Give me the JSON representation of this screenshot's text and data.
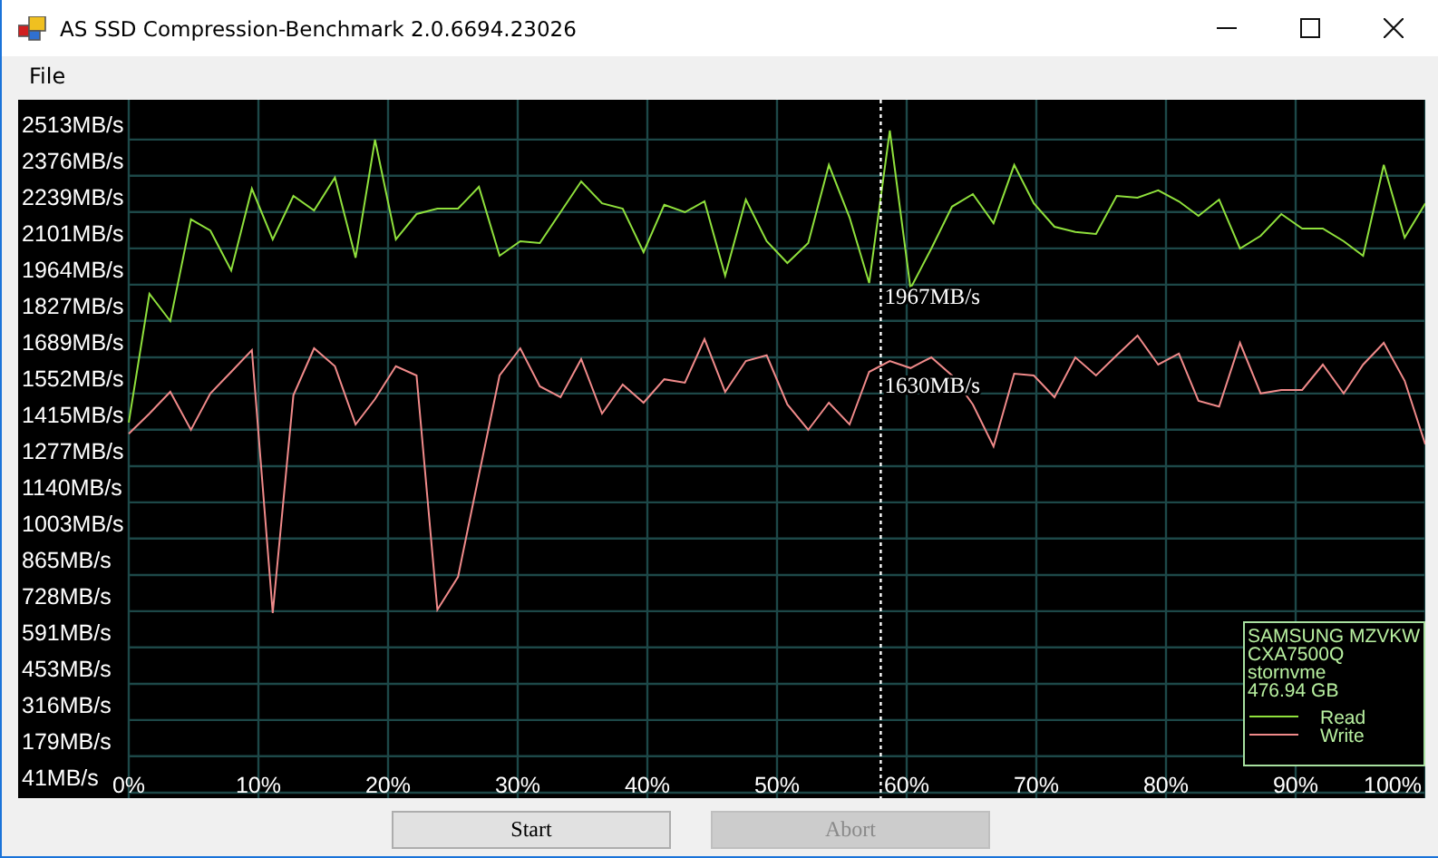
{
  "window": {
    "title": "AS SSD Compression-Benchmark 2.0.6694.23026"
  },
  "menu": [
    {
      "label": "File"
    }
  ],
  "chart": {
    "chart_data": {
      "type": "line",
      "x": [
        0,
        1.6,
        3.2,
        4.8,
        6.3,
        7.9,
        9.5,
        11.1,
        12.7,
        14.3,
        15.9,
        17.5,
        19.0,
        20.6,
        22.2,
        23.8,
        25.4,
        27.0,
        28.6,
        30.2,
        31.7,
        33.3,
        34.9,
        36.5,
        38.1,
        39.7,
        41.3,
        42.9,
        44.4,
        46.0,
        47.6,
        49.2,
        50.8,
        52.4,
        54.0,
        55.6,
        57.1,
        58.7,
        60.3,
        61.9,
        63.5,
        65.1,
        66.7,
        68.3,
        69.8,
        71.4,
        73.0,
        74.6,
        76.2,
        77.8,
        79.4,
        81.0,
        82.5,
        84.1,
        85.7,
        87.3,
        88.9,
        90.5,
        92.1,
        93.7,
        95.2,
        96.8,
        98.4,
        100
      ],
      "series": [
        {
          "name": "Read",
          "color": "#8fe03c",
          "values": [
            1442,
            1929,
            1826,
            2211,
            2169,
            2018,
            2327,
            2135,
            2300,
            2245,
            2369,
            2066,
            2513,
            2135,
            2231,
            2252,
            2252,
            2334,
            2073,
            2128,
            2121,
            2238,
            2355,
            2272,
            2252,
            2087,
            2266,
            2238,
            2279,
            1998,
            2286,
            2128,
            2046,
            2121,
            2417,
            2218,
            1970,
            2547,
            1950,
            2101,
            2259,
            2307,
            2197,
            2417,
            2272,
            2183,
            2163,
            2156,
            2300,
            2293,
            2321,
            2279,
            2224,
            2286,
            2101,
            2149,
            2231,
            2176,
            2176,
            2128,
            2073,
            2417,
            2142,
            2272
          ]
        },
        {
          "name": "Write",
          "color": "#f08a8a",
          "values": [
            1400,
            1476,
            1558,
            1414,
            1552,
            1634,
            1716,
            721,
            1545,
            1723,
            1655,
            1435,
            1531,
            1655,
            1620,
            734,
            858,
            1243,
            1620,
            1723,
            1579,
            1538,
            1682,
            1476,
            1586,
            1517,
            1606,
            1593,
            1758,
            1558,
            1675,
            1696,
            1510,
            1414,
            1517,
            1435,
            1634,
            1675,
            1648,
            1689,
            1620,
            1510,
            1352,
            1627,
            1620,
            1538,
            1689,
            1620,
            1696,
            1771,
            1661,
            1703,
            1524,
            1503,
            1744,
            1552,
            1565,
            1565,
            1661,
            1552,
            1661,
            1744,
            1600,
            1359
          ]
        }
      ],
      "xlim": [
        0,
        100
      ],
      "ylim": [
        41,
        2650
      ],
      "xticks": [
        {
          "value": 0,
          "label": "0%"
        },
        {
          "value": 10,
          "label": "10%"
        },
        {
          "value": 20,
          "label": "20%"
        },
        {
          "value": 30,
          "label": "30%"
        },
        {
          "value": 40,
          "label": "40%"
        },
        {
          "value": 50,
          "label": "50%"
        },
        {
          "value": 60,
          "label": "60%"
        },
        {
          "value": 70,
          "label": "70%"
        },
        {
          "value": 80,
          "label": "80%"
        },
        {
          "value": 90,
          "label": "90%"
        },
        {
          "value": 100,
          "label": "100%"
        }
      ],
      "yticks": [
        {
          "value": 2513,
          "label": "2513MB/s"
        },
        {
          "value": 2376,
          "label": "2376MB/s"
        },
        {
          "value": 2239,
          "label": "2239MB/s"
        },
        {
          "value": 2101,
          "label": "2101MB/s"
        },
        {
          "value": 1964,
          "label": "1964MB/s"
        },
        {
          "value": 1827,
          "label": "1827MB/s"
        },
        {
          "value": 1689,
          "label": "1689MB/s"
        },
        {
          "value": 1552,
          "label": "1552MB/s"
        },
        {
          "value": 1415,
          "label": "1415MB/s"
        },
        {
          "value": 1277,
          "label": "1277MB/s"
        },
        {
          "value": 1140,
          "label": "1140MB/s"
        },
        {
          "value": 1003,
          "label": "1003MB/s"
        },
        {
          "value": 865,
          "label": "865MB/s"
        },
        {
          "value": 728,
          "label": "728MB/s"
        },
        {
          "value": 591,
          "label": "591MB/s"
        },
        {
          "value": 453,
          "label": "453MB/s"
        },
        {
          "value": 316,
          "label": "316MB/s"
        },
        {
          "value": 179,
          "label": "179MB/s"
        },
        {
          "value": 41,
          "label": "41MB/s"
        }
      ],
      "grid": true,
      "ref_lines": [
        {
          "axis": "x",
          "value": 58,
          "color": "#ffffff"
        }
      ],
      "annotations": [
        {
          "x": 58,
          "y": 1967,
          "text": "1967MB/s"
        },
        {
          "x": 58,
          "y": 1630,
          "text": "1630MB/s"
        }
      ],
      "legend": {
        "lines": [
          "SAMSUNG MZVKW",
          "CXA7500Q",
          "stornvme",
          "476.94 GB"
        ]
      }
    }
  },
  "buttons": [
    {
      "label": "Start",
      "disabled": false
    },
    {
      "label": "Abort",
      "disabled": true
    }
  ]
}
